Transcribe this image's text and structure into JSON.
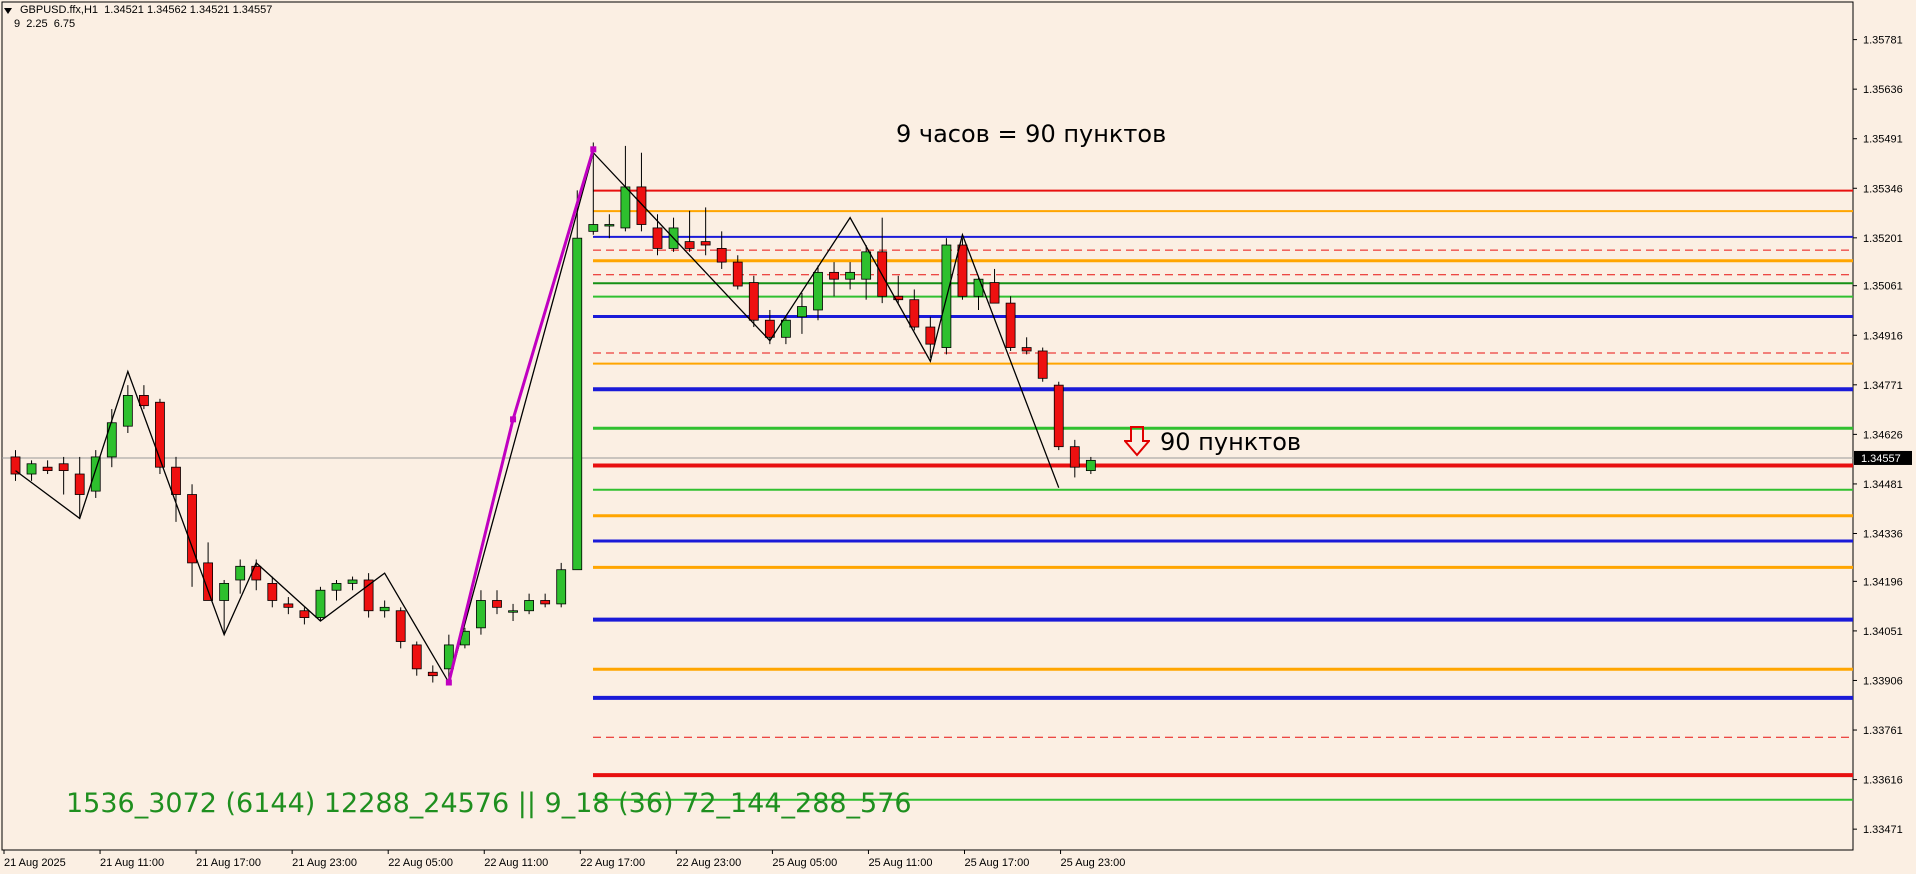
{
  "header": {
    "symbol_line": "GBPUSD.ffx,H1  1.34521 1.34562 1.34521 1.34557",
    "params_line": "9  2.25  6.75"
  },
  "annotations": {
    "top_text": "9 часов = 90 пунктов",
    "pips_text": "90  пунктов",
    "bottom_text": "1536_3072 (6144) 12288_24576 || 9_18 (36) 72_144_288_576",
    "arrow_icon": "down-arrow-icon",
    "top_text_color": "#000000",
    "bottom_text_color": "#1f8f1f",
    "arrow_color": "#e00000"
  },
  "chart_data": {
    "type": "candlestick",
    "symbol": "GBPUSD.ffx",
    "timeframe": "H1",
    "current_price": "1.34557",
    "y_ticks": [
      "1.35781",
      "1.35636",
      "1.35491",
      "1.35346",
      "1.35201",
      "1.35061",
      "1.34916",
      "1.34771",
      "1.34626",
      "1.34481",
      "1.34336",
      "1.34196",
      "1.34051",
      "1.33906",
      "1.33761",
      "1.33616",
      "1.33471"
    ],
    "x_ticks": [
      "21 Aug 2025",
      "21 Aug 11:00",
      "21 Aug 17:00",
      "21 Aug 23:00",
      "22 Aug 05:00",
      "22 Aug 11:00",
      "22 Aug 17:00",
      "22 Aug 23:00",
      "25 Aug 05:00",
      "25 Aug 11:00",
      "25 Aug 17:00",
      "25 Aug 23:00"
    ],
    "ylim": [
      1.3341,
      1.35891
    ],
    "candles": [
      [
        1.3456,
        1.3458,
        1.3449,
        1.3451
      ],
      [
        1.3451,
        1.3455,
        1.3449,
        1.3454
      ],
      [
        1.3453,
        1.3455,
        1.3451,
        1.3452
      ],
      [
        1.3454,
        1.3456,
        1.3445,
        1.3452
      ],
      [
        1.3451,
        1.3456,
        1.3438,
        1.3445
      ],
      [
        1.3446,
        1.3458,
        1.3444,
        1.3456
      ],
      [
        1.3456,
        1.347,
        1.3453,
        1.3466
      ],
      [
        1.3465,
        1.3477,
        1.3463,
        1.3474
      ],
      [
        1.3474,
        1.3477,
        1.347,
        1.3471
      ],
      [
        1.3472,
        1.3473,
        1.3451,
        1.3453
      ],
      [
        1.3453,
        1.3456,
        1.3437,
        1.3445
      ],
      [
        1.3445,
        1.3448,
        1.3418,
        1.3425
      ],
      [
        1.3425,
        1.3431,
        1.3415,
        1.3414
      ],
      [
        1.3414,
        1.342,
        1.3404,
        1.3419
      ],
      [
        1.342,
        1.3426,
        1.3416,
        1.3424
      ],
      [
        1.3424,
        1.3426,
        1.3417,
        1.342
      ],
      [
        1.3419,
        1.3421,
        1.3412,
        1.3414
      ],
      [
        1.3413,
        1.3415,
        1.341,
        1.3412
      ],
      [
        1.3411,
        1.3412,
        1.3407,
        1.3409
      ],
      [
        1.3409,
        1.3418,
        1.3408,
        1.3417
      ],
      [
        1.3417,
        1.342,
        1.3414,
        1.3419
      ],
      [
        1.3419,
        1.3421,
        1.3417,
        1.342
      ],
      [
        1.342,
        1.3422,
        1.3409,
        1.3411
      ],
      [
        1.3411,
        1.3414,
        1.3409,
        1.3412
      ],
      [
        1.3411,
        1.3412,
        1.34,
        1.3402
      ],
      [
        1.3401,
        1.3402,
        1.3392,
        1.3394
      ],
      [
        1.3393,
        1.3395,
        1.339,
        1.3392
      ],
      [
        1.3394,
        1.3404,
        1.339,
        1.3401
      ],
      [
        1.3401,
        1.3406,
        1.34,
        1.3405
      ],
      [
        1.3406,
        1.3417,
        1.3404,
        1.3414
      ],
      [
        1.3414,
        1.3417,
        1.341,
        1.3412
      ],
      [
        1.3411,
        1.3413,
        1.3408,
        1.3411
      ],
      [
        1.3411,
        1.3416,
        1.341,
        1.3414
      ],
      [
        1.3414,
        1.3416,
        1.3412,
        1.3413
      ],
      [
        1.3413,
        1.3425,
        1.3412,
        1.3423
      ],
      [
        1.3423,
        1.3534,
        1.3423,
        1.352
      ],
      [
        1.3522,
        1.3548,
        1.3521,
        1.3524
      ],
      [
        1.3524,
        1.3527,
        1.352,
        1.3524
      ],
      [
        1.3523,
        1.3547,
        1.3522,
        1.3535
      ],
      [
        1.3535,
        1.3545,
        1.3522,
        1.3524
      ],
      [
        1.3523,
        1.3527,
        1.3515,
        1.3517
      ],
      [
        1.3517,
        1.3526,
        1.3516,
        1.3523
      ],
      [
        1.3519,
        1.3528,
        1.3516,
        1.3517
      ],
      [
        1.3519,
        1.3529,
        1.3515,
        1.3518
      ],
      [
        1.3517,
        1.3522,
        1.3511,
        1.3513
      ],
      [
        1.3513,
        1.3515,
        1.3505,
        1.3506
      ],
      [
        1.3507,
        1.3509,
        1.3494,
        1.3496
      ],
      [
        1.3496,
        1.3499,
        1.3489,
        1.3491
      ],
      [
        1.3491,
        1.3497,
        1.3489,
        1.3496
      ],
      [
        1.3497,
        1.3504,
        1.3492,
        1.35
      ],
      [
        1.3499,
        1.3512,
        1.3496,
        1.351
      ],
      [
        1.351,
        1.3513,
        1.3503,
        1.3508
      ],
      [
        1.3508,
        1.3513,
        1.3505,
        1.351
      ],
      [
        1.3508,
        1.3518,
        1.3502,
        1.3516
      ],
      [
        1.3516,
        1.3526,
        1.3501,
        1.3503
      ],
      [
        1.3503,
        1.3509,
        1.3501,
        1.3502
      ],
      [
        1.3502,
        1.3505,
        1.3493,
        1.3494
      ],
      [
        1.3494,
        1.3497,
        1.3485,
        1.3489
      ],
      [
        1.3488,
        1.352,
        1.3486,
        1.3518
      ],
      [
        1.3518,
        1.352,
        1.3502,
        1.3503
      ],
      [
        1.3503,
        1.3509,
        1.3499,
        1.3508
      ],
      [
        1.3507,
        1.3511,
        1.3501,
        1.3501
      ],
      [
        1.3501,
        1.3503,
        1.3487,
        1.3488
      ],
      [
        1.3488,
        1.3491,
        1.3486,
        1.3487
      ],
      [
        1.3487,
        1.3488,
        1.3478,
        1.3479
      ],
      [
        1.3477,
        1.3478,
        1.3458,
        1.3459
      ],
      [
        1.3459,
        1.3461,
        1.345,
        1.3453
      ],
      [
        1.3452,
        1.3456,
        1.3451,
        1.3455
      ]
    ],
    "zigzag_black": [
      [
        0,
        1.3452
      ],
      [
        4,
        1.3438
      ],
      [
        7,
        1.3481
      ],
      [
        13,
        1.3404
      ],
      [
        15,
        1.3425
      ],
      [
        19,
        1.3408
      ],
      [
        23,
        1.3422
      ],
      [
        27,
        1.339
      ],
      [
        36,
        1.3545
      ],
      [
        47,
        1.349
      ],
      [
        52,
        1.3526
      ],
      [
        57,
        1.3484
      ],
      [
        59,
        1.3521
      ],
      [
        65,
        1.3447
      ]
    ],
    "zigzag_magenta": [
      [
        27,
        1.339
      ],
      [
        31,
        1.3467
      ],
      [
        36,
        1.3546
      ]
    ],
    "h_lines": [
      {
        "price": 1.35339,
        "color": "#e81010",
        "style": "solid",
        "weight": 2
      },
      {
        "price": 1.35279,
        "color": "#ffa500",
        "style": "solid",
        "weight": 2
      },
      {
        "price": 1.35204,
        "color": "#1a1ad8",
        "style": "solid",
        "weight": 2
      },
      {
        "price": 1.35165,
        "color": "#e81010",
        "style": "dash",
        "weight": 1
      },
      {
        "price": 1.35134,
        "color": "#ffa500",
        "style": "solid",
        "weight": 3
      },
      {
        "price": 1.35093,
        "color": "#e81010",
        "style": "dash",
        "weight": 1
      },
      {
        "price": 1.35068,
        "color": "#159015",
        "style": "solid",
        "weight": 2
      },
      {
        "price": 1.35029,
        "color": "#30c030",
        "style": "solid",
        "weight": 2
      },
      {
        "price": 1.34971,
        "color": "#1a1ad8",
        "style": "solid",
        "weight": 3
      },
      {
        "price": 1.34864,
        "color": "#e81010",
        "style": "dash",
        "weight": 1
      },
      {
        "price": 1.34833,
        "color": "#ffa500",
        "style": "solid",
        "weight": 2
      },
      {
        "price": 1.34758,
        "color": "#1a1ad8",
        "style": "solid",
        "weight": 4
      },
      {
        "price": 1.34644,
        "color": "#30c030",
        "style": "solid",
        "weight": 3
      },
      {
        "price": 1.34535,
        "color": "#e81010",
        "style": "solid",
        "weight": 4
      },
      {
        "price": 1.34464,
        "color": "#30c030",
        "style": "solid",
        "weight": 2
      },
      {
        "price": 1.34388,
        "color": "#ffa500",
        "style": "solid",
        "weight": 3
      },
      {
        "price": 1.34314,
        "color": "#1a1ad8",
        "style": "solid",
        "weight": 3
      },
      {
        "price": 1.34237,
        "color": "#ffa500",
        "style": "solid",
        "weight": 3
      },
      {
        "price": 1.34084,
        "color": "#1a1ad8",
        "style": "solid",
        "weight": 4
      },
      {
        "price": 1.33939,
        "color": "#ffa500",
        "style": "solid",
        "weight": 3
      },
      {
        "price": 1.33855,
        "color": "#1a1ad8",
        "style": "solid",
        "weight": 4
      },
      {
        "price": 1.3374,
        "color": "#e81010",
        "style": "dash",
        "weight": 1
      },
      {
        "price": 1.33629,
        "color": "#e81010",
        "style": "solid",
        "weight": 4
      },
      {
        "price": 1.33557,
        "color": "#30c030",
        "style": "solid",
        "weight": 2
      }
    ],
    "colors": {
      "background": "#fbefe3",
      "bull": "#2ec02e",
      "bear": "#ee1010",
      "wick": "#000000",
      "price_line": "#9a9a9a",
      "price_tag_bg": "#000000",
      "price_tag_fg": "#ffffff",
      "zigzag": "#000000",
      "zigzag2": "#c000c0"
    }
  }
}
